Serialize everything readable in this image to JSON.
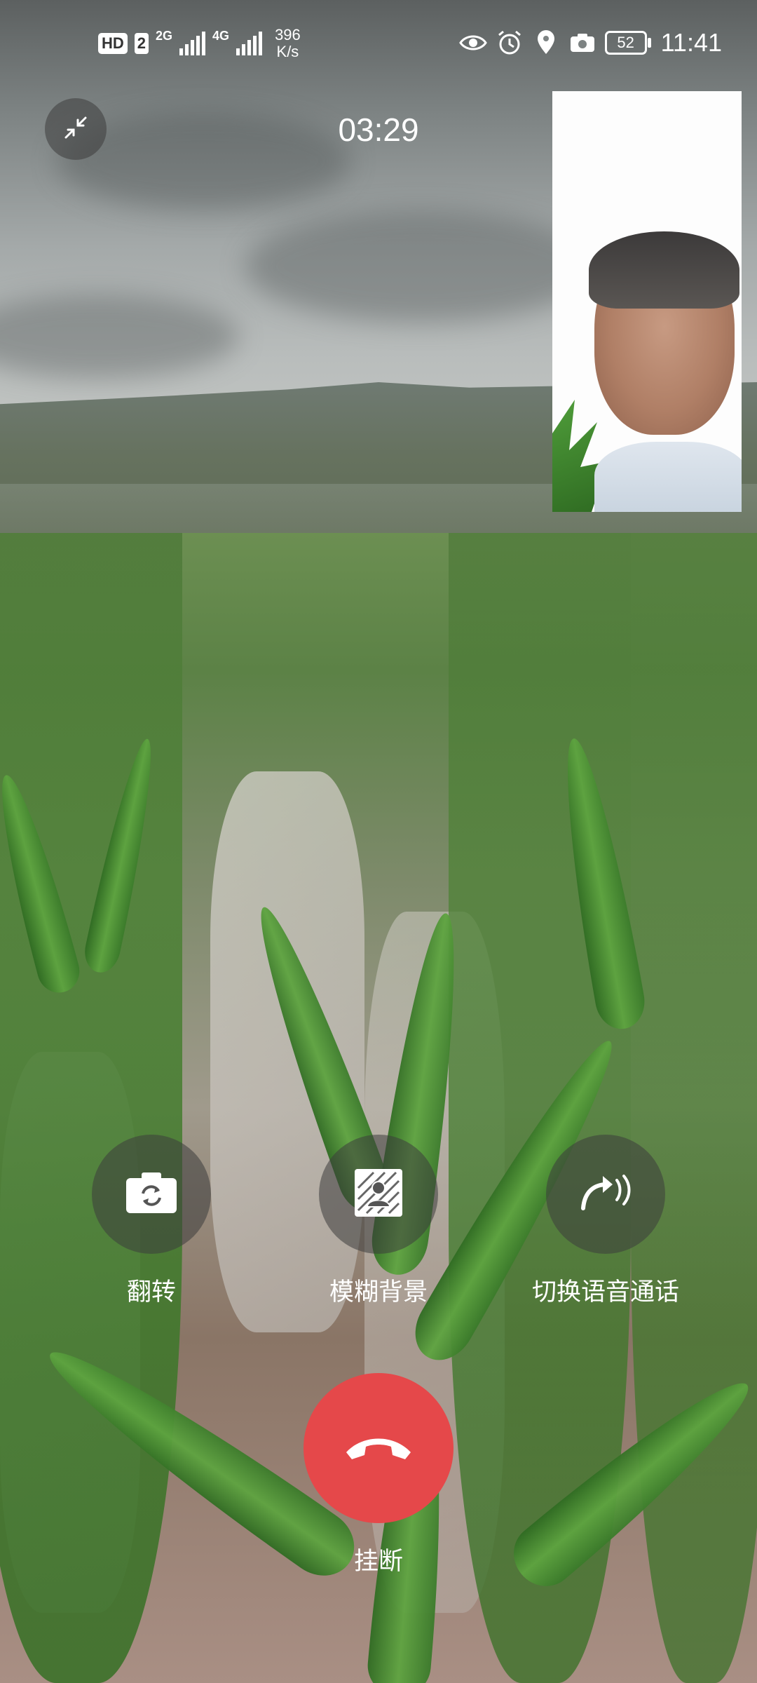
{
  "status_bar": {
    "hd_label": "HD",
    "sim_label": "2",
    "network_1": "2G",
    "network_2": "4G",
    "speed_value": "396",
    "speed_unit": "K/s",
    "battery_level": "52",
    "time": "11:41",
    "icons": [
      "eye-icon",
      "alarm-icon",
      "location-icon",
      "camera-icon",
      "battery-icon"
    ]
  },
  "call": {
    "duration": "03:29",
    "minimize_icon": "minimize-icon"
  },
  "controls": {
    "flip": {
      "label": "翻转",
      "icon": "camera-flip-icon"
    },
    "blur": {
      "label": "模糊背景",
      "icon": "blur-background-icon"
    },
    "switch_voice": {
      "label": "切换语音通话",
      "icon": "switch-to-voice-icon"
    },
    "hangup": {
      "label": "挂断",
      "icon": "hangup-icon",
      "color": "#e5484a"
    }
  }
}
